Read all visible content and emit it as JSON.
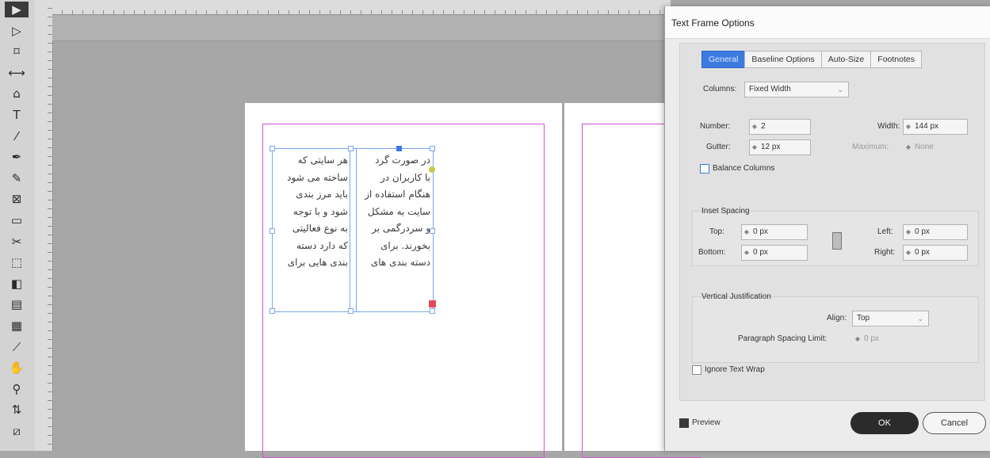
{
  "toolbar": {
    "tools": [
      {
        "name": "selection-tool-icon",
        "glyph": "▶",
        "active": true
      },
      {
        "name": "direct-selection-tool-icon",
        "glyph": "▷"
      },
      {
        "name": "page-tool-icon",
        "glyph": "⌑"
      },
      {
        "name": "gap-tool-icon",
        "glyph": "⟷"
      },
      {
        "name": "content-collector-icon",
        "glyph": "⌂"
      },
      {
        "name": "type-tool-icon",
        "glyph": "T"
      },
      {
        "name": "line-tool-icon",
        "glyph": "⁄"
      },
      {
        "name": "pen-tool-icon",
        "glyph": "✒"
      },
      {
        "name": "pencil-tool-icon",
        "glyph": "✎"
      },
      {
        "name": "rectangle-frame-tool-icon",
        "glyph": "⊠"
      },
      {
        "name": "rectangle-tool-icon",
        "glyph": "▭"
      },
      {
        "name": "scissors-tool-icon",
        "glyph": "✂"
      },
      {
        "name": "free-transform-tool-icon",
        "glyph": "⬚"
      },
      {
        "name": "gradient-swatch-tool-icon",
        "glyph": "◧"
      },
      {
        "name": "gradient-feather-tool-icon",
        "glyph": "▤"
      },
      {
        "name": "note-tool-icon",
        "glyph": "▦"
      },
      {
        "name": "eyedropper-tool-icon",
        "glyph": "⟋"
      },
      {
        "name": "hand-tool-icon",
        "glyph": "✋"
      },
      {
        "name": "zoom-tool-icon",
        "glyph": "⚲"
      },
      {
        "name": "swap-fill-stroke-icon",
        "glyph": "⇅"
      },
      {
        "name": "fill-stroke-icon",
        "glyph": "⧄"
      }
    ]
  },
  "document": {
    "column_right_lines": [
      "در صورت گرد",
      "با کاربران در",
      "هنگام استفاده از",
      "سایت به مشکل",
      "و سردرگمی بر",
      "بخورند. برای",
      "دسته بندی های"
    ],
    "column_left_lines": [
      "هر سایتی که",
      "ساخته می شود",
      "باید مرز بندی",
      "شود و با توجه",
      "به نوع فعالیتی",
      "که دارد دسته",
      "بندی هایی برای"
    ]
  },
  "dialog": {
    "title": "Text Frame Options",
    "tabs": [
      "General",
      "Baseline Options",
      "Auto-Size",
      "Footnotes"
    ],
    "active_tab": "General",
    "columns_label": "Columns:",
    "columns_value": "Fixed Width",
    "number_label": "Number:",
    "number_value": "2",
    "width_label": "Width:",
    "width_value": "144 px",
    "gutter_label": "Gutter:",
    "gutter_value": "12 px",
    "maximum_label": "Maximum:",
    "maximum_value": "None",
    "balance_columns_label": "Balance Columns",
    "inset_spacing_title": "Inset Spacing",
    "top_label": "Top:",
    "top_value": "0 px",
    "bottom_label": "Bottom:",
    "bottom_value": "0 px",
    "left_label": "Left:",
    "left_value": "0 px",
    "right_label": "Right:",
    "right_value": "0 px",
    "vertical_justification_title": "Vertical Justification",
    "align_label": "Align:",
    "align_value": "Top",
    "paragraph_spacing_limit_label": "Paragraph Spacing Limit:",
    "paragraph_spacing_limit_value": "0 px",
    "ignore_text_wrap_label": "Ignore Text Wrap",
    "preview_label": "Preview",
    "preview_checked": true,
    "ok_label": "OK",
    "cancel_label": "Cancel"
  },
  "colors": {
    "margin_guide": "#d64fd6",
    "frame_edge": "#79a7e8",
    "active_tab": "#3d7ae0"
  }
}
